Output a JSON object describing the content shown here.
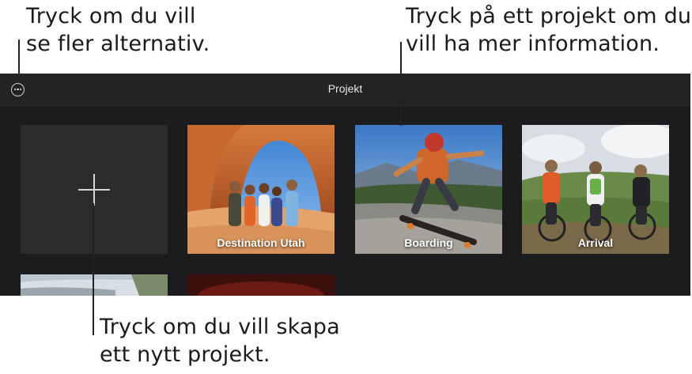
{
  "callouts": {
    "more_options": [
      "Tryck om du vill",
      "se fler alternativ."
    ],
    "project_info": [
      "Tryck på ett projekt om du",
      "vill ha mer information."
    ],
    "new_project": [
      "Tryck om du vill skapa",
      "ett nytt projekt."
    ]
  },
  "navbar": {
    "title": "Projekt",
    "more_icon": "ellipsis-circle-icon"
  },
  "projects": [
    {
      "label": "Destination Utah"
    },
    {
      "label": "Boarding"
    },
    {
      "label": "Arrival"
    }
  ],
  "colors": {
    "app_background": "#1c1c1e",
    "navbar": "#232325",
    "new_tile": "#2c2c2e"
  }
}
